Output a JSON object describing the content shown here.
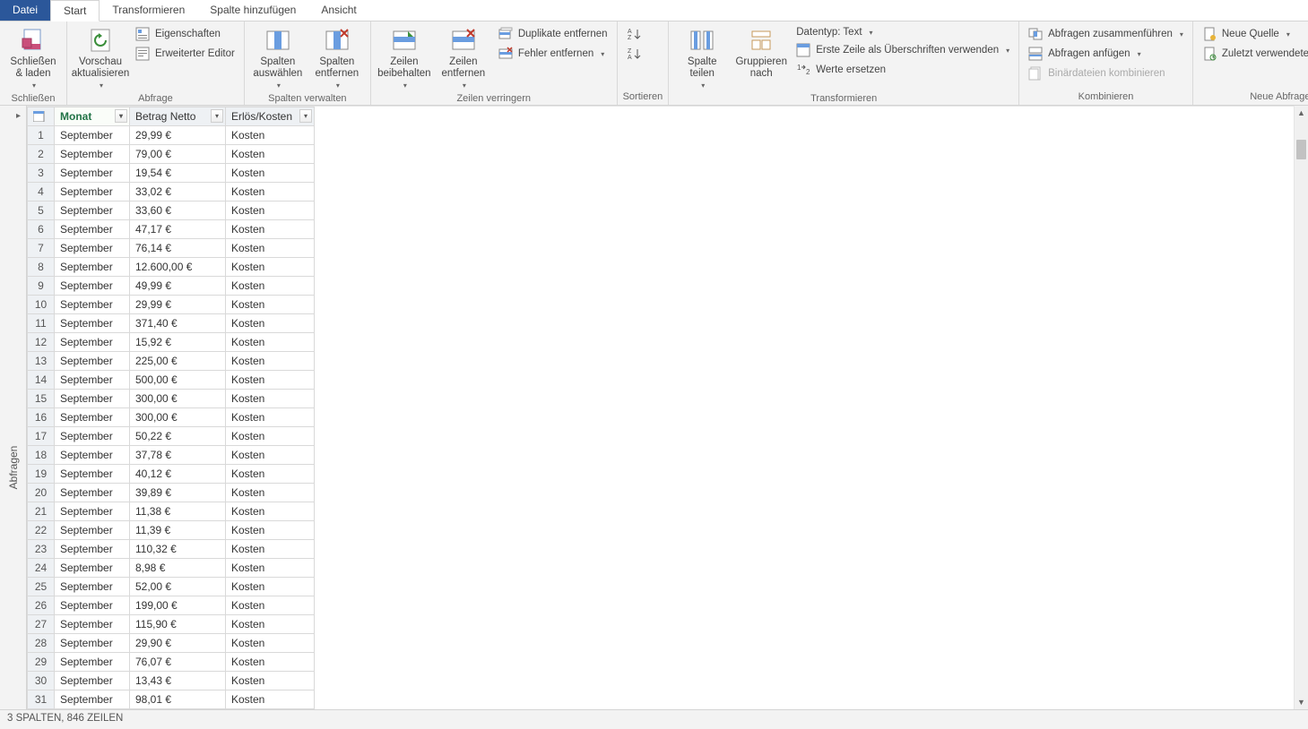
{
  "tabs": {
    "file": "Datei",
    "start": "Start",
    "transform": "Transformieren",
    "addcol": "Spalte hinzufügen",
    "view": "Ansicht"
  },
  "ribbon": {
    "close": {
      "big": "Schließen\n& laden",
      "label": "Schließen"
    },
    "query": {
      "refresh": "Vorschau\naktualisieren",
      "props": "Eigenschaften",
      "adv": "Erweiterter Editor",
      "label": "Abfrage"
    },
    "cols": {
      "choose": "Spalten\nauswählen",
      "remove": "Spalten\nentfernen",
      "label": "Spalten verwalten"
    },
    "rows": {
      "keep": "Zeilen\nbeibehalten",
      "remove": "Zeilen\nentfernen",
      "dup": "Duplikate entfernen",
      "err": "Fehler entfernen",
      "label": "Zeilen verringern"
    },
    "sort": {
      "label": "Sortieren"
    },
    "trans": {
      "split": "Spalte\nteilen",
      "group": "Gruppieren\nnach",
      "dtype": "Datentyp: Text",
      "firstrow": "Erste Zeile als Überschriften verwenden",
      "replace": "Werte ersetzen",
      "label": "Transformieren"
    },
    "combine": {
      "merge": "Abfragen zusammenführen",
      "append": "Abfragen anfügen",
      "binary": "Binärdateien kombinieren",
      "label": "Kombinieren"
    },
    "new": {
      "source": "Neue Quelle",
      "recent": "Zuletzt verwendete Quellen",
      "label": "Neue Abfrage"
    }
  },
  "side": {
    "label": "Abfragen"
  },
  "columns": {
    "c1": "Monat",
    "c2": "Betrag Netto",
    "c3": "Erlös/Kosten"
  },
  "rows_data": [
    {
      "n": 1,
      "m": "September",
      "b": "29,99 €",
      "e": "Kosten"
    },
    {
      "n": 2,
      "m": "September",
      "b": "79,00 €",
      "e": "Kosten"
    },
    {
      "n": 3,
      "m": "September",
      "b": "19,54 €",
      "e": "Kosten"
    },
    {
      "n": 4,
      "m": "September",
      "b": "33,02 €",
      "e": "Kosten"
    },
    {
      "n": 5,
      "m": "September",
      "b": "33,60 €",
      "e": "Kosten"
    },
    {
      "n": 6,
      "m": "September",
      "b": "47,17 €",
      "e": "Kosten"
    },
    {
      "n": 7,
      "m": "September",
      "b": "76,14 €",
      "e": "Kosten"
    },
    {
      "n": 8,
      "m": "September",
      "b": "12.600,00 €",
      "e": "Kosten"
    },
    {
      "n": 9,
      "m": "September",
      "b": "49,99 €",
      "e": "Kosten"
    },
    {
      "n": 10,
      "m": "September",
      "b": "29,99 €",
      "e": "Kosten"
    },
    {
      "n": 11,
      "m": "September",
      "b": "371,40 €",
      "e": "Kosten"
    },
    {
      "n": 12,
      "m": "September",
      "b": "15,92 €",
      "e": "Kosten"
    },
    {
      "n": 13,
      "m": "September",
      "b": "225,00 €",
      "e": "Kosten"
    },
    {
      "n": 14,
      "m": "September",
      "b": "500,00 €",
      "e": "Kosten"
    },
    {
      "n": 15,
      "m": "September",
      "b": "300,00 €",
      "e": "Kosten"
    },
    {
      "n": 16,
      "m": "September",
      "b": "300,00 €",
      "e": "Kosten"
    },
    {
      "n": 17,
      "m": "September",
      "b": "50,22 €",
      "e": "Kosten"
    },
    {
      "n": 18,
      "m": "September",
      "b": "37,78 €",
      "e": "Kosten"
    },
    {
      "n": 19,
      "m": "September",
      "b": "40,12 €",
      "e": "Kosten"
    },
    {
      "n": 20,
      "m": "September",
      "b": "39,89 €",
      "e": "Kosten"
    },
    {
      "n": 21,
      "m": "September",
      "b": "11,38 €",
      "e": "Kosten"
    },
    {
      "n": 22,
      "m": "September",
      "b": "11,39 €",
      "e": "Kosten"
    },
    {
      "n": 23,
      "m": "September",
      "b": "110,32 €",
      "e": "Kosten"
    },
    {
      "n": 24,
      "m": "September",
      "b": "8,98 €",
      "e": "Kosten"
    },
    {
      "n": 25,
      "m": "September",
      "b": "52,00 €",
      "e": "Kosten"
    },
    {
      "n": 26,
      "m": "September",
      "b": "199,00 €",
      "e": "Kosten"
    },
    {
      "n": 27,
      "m": "September",
      "b": "115,90 €",
      "e": "Kosten"
    },
    {
      "n": 28,
      "m": "September",
      "b": "29,90 €",
      "e": "Kosten"
    },
    {
      "n": 29,
      "m": "September",
      "b": "76,07 €",
      "e": "Kosten"
    },
    {
      "n": 30,
      "m": "September",
      "b": "13,43 €",
      "e": "Kosten"
    },
    {
      "n": 31,
      "m": "September",
      "b": "98,01 €",
      "e": "Kosten"
    }
  ],
  "status": "3 SPALTEN, 846 ZEILEN"
}
